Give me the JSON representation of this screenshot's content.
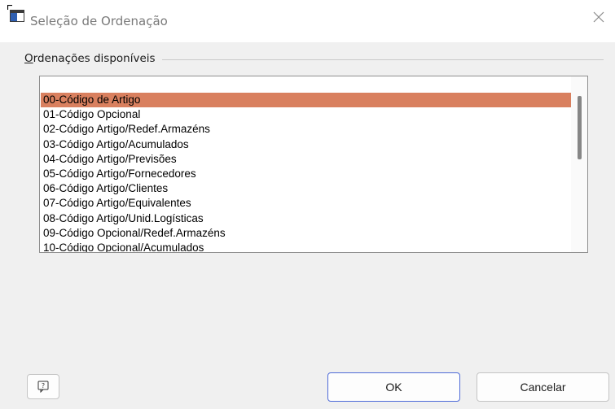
{
  "window": {
    "title": "Seleção de Ordenação",
    "icon": "window-app-icon",
    "close_icon": "close-icon"
  },
  "group": {
    "label_accel": "O",
    "label_rest": "rdenações disponíveis"
  },
  "list": {
    "selected_index": 0,
    "items": [
      "00-Código de Artigo",
      "01-Código Opcional",
      "02-Código Artigo/Redef.Armazéns",
      "03-Código Artigo/Acumulados",
      "04-Código Artigo/Previsões",
      "05-Código Artigo/Fornecedores",
      "06-Código Artigo/Clientes",
      "07-Código Artigo/Equivalentes",
      "08-Código Artigo/Unid.Logísticas",
      "09-Código Opcional/Redef.Armazéns",
      "10-Código Opcional/Acumulados"
    ]
  },
  "buttons": {
    "help_icon": "help-icon",
    "ok": "OK",
    "cancel": "Cancelar"
  },
  "colors": {
    "selection": "#d9805f",
    "ok_border": "#4f6bd8"
  }
}
